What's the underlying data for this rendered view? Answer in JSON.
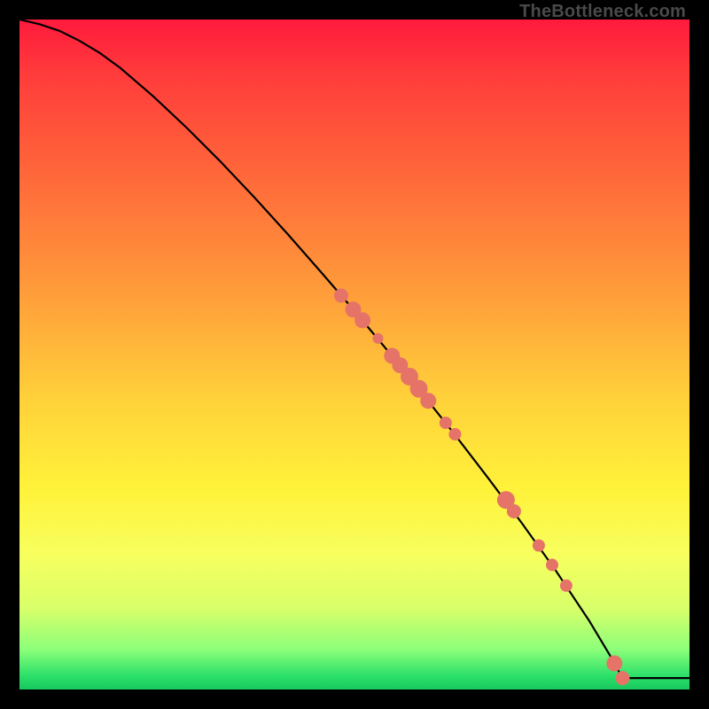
{
  "attribution": "TheBottleneck.com",
  "colors": {
    "gradient_top": "#ff1a3d",
    "gradient_bottom": "#18c85e",
    "line": "#000000",
    "point": "#e57368",
    "frame": "#000000"
  },
  "chart_data": {
    "type": "line",
    "title": "",
    "xlabel": "",
    "ylabel": "",
    "xlim": [
      0,
      100
    ],
    "ylim": [
      0,
      100
    ],
    "grid": false,
    "legend": false,
    "series": [
      {
        "name": "curve",
        "x": [
          0,
          3,
          6,
          9,
          12,
          15,
          20,
          25,
          30,
          35,
          40,
          45,
          50,
          55,
          60,
          65,
          70,
          75,
          80,
          85,
          88,
          90,
          100
        ],
        "y": [
          100,
          99.3,
          98.3,
          96.8,
          95.0,
          92.8,
          88.5,
          83.8,
          78.8,
          73.5,
          68.0,
          62.3,
          56.5,
          50.5,
          44.3,
          38.0,
          31.5,
          24.8,
          17.8,
          10.3,
          5.3,
          1.7,
          1.7
        ]
      }
    ],
    "points": [
      {
        "x": 48.0,
        "y": 58.8,
        "r": 8
      },
      {
        "x": 49.8,
        "y": 56.7,
        "r": 9
      },
      {
        "x": 51.2,
        "y": 55.1,
        "r": 9
      },
      {
        "x": 53.5,
        "y": 52.4,
        "r": 6
      },
      {
        "x": 55.6,
        "y": 49.8,
        "r": 9
      },
      {
        "x": 56.8,
        "y": 48.4,
        "r": 9
      },
      {
        "x": 58.2,
        "y": 46.7,
        "r": 10
      },
      {
        "x": 59.6,
        "y": 44.9,
        "r": 10
      },
      {
        "x": 61.0,
        "y": 43.1,
        "r": 9
      },
      {
        "x": 63.6,
        "y": 39.8,
        "r": 7
      },
      {
        "x": 65.0,
        "y": 38.1,
        "r": 7
      },
      {
        "x": 72.6,
        "y": 28.3,
        "r": 10
      },
      {
        "x": 73.8,
        "y": 26.6,
        "r": 8
      },
      {
        "x": 77.5,
        "y": 21.5,
        "r": 7
      },
      {
        "x": 79.5,
        "y": 18.6,
        "r": 7
      },
      {
        "x": 81.6,
        "y": 15.5,
        "r": 7
      },
      {
        "x": 88.8,
        "y": 3.9,
        "r": 9
      },
      {
        "x": 90.0,
        "y": 1.7,
        "r": 8
      }
    ]
  }
}
